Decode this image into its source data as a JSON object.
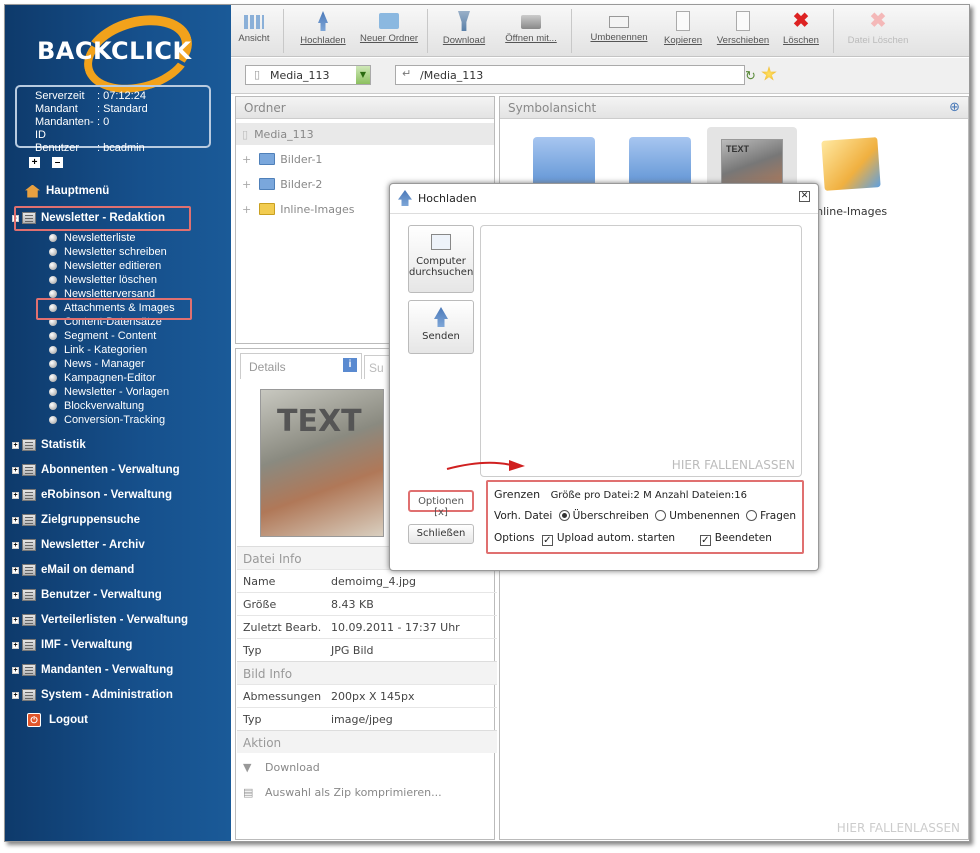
{
  "brand": {
    "logo_text": "BACKCLICK",
    "accent": "#f2a21b"
  },
  "server_info": [
    {
      "label": "Serverzeit",
      "value": ": 07:12:24"
    },
    {
      "label": "Mandant",
      "value": ": Standard"
    },
    {
      "label": "Mandanten-ID",
      "value": ": 0"
    },
    {
      "label": "Benutzer",
      "value": ": bcadmin"
    }
  ],
  "nav": {
    "home": "Hauptmenü",
    "active_section": "Newsletter - Redaktion",
    "sub_items": [
      "Newsletterliste",
      "Newsletter schreiben",
      "Newsletter editieren",
      "Newsletter löschen",
      "Newsletterversand",
      "Attachments & Images",
      "Content-Datensätze",
      "Segment - Content",
      "Link - Kategorien",
      "News - Manager",
      "Kampagnen-Editor",
      "Newsletter - Vorlagen",
      "Blockverwaltung",
      "Conversion-Tracking"
    ],
    "sections": [
      "Statistik",
      "Abonnenten - Verwaltung",
      "eRobinson - Verwaltung",
      "Zielgruppensuche",
      "Newsletter - Archiv",
      "eMail on demand",
      "Benutzer - Verwaltung",
      "Verteilerlisten - Verwaltung",
      "IMF - Verwaltung",
      "Mandanten - Verwaltung",
      "System - Administration"
    ],
    "logout": "Logout"
  },
  "toolbar": [
    "Ansicht",
    "Hochladen",
    "Neuer Ordner",
    "Download",
    "Öffnen mit...",
    "Umbenennen",
    "Kopieren",
    "Verschieben",
    "Löschen",
    "Datei Löschen"
  ],
  "path": {
    "root": "Media_113",
    "current": "/Media_113"
  },
  "folders_panel": {
    "title": "Ordner",
    "root": "Media_113",
    "items": [
      "Bilder-1",
      "Bilder-2",
      "Inline-Images"
    ]
  },
  "icons_panel": {
    "title": "Symbolansicht",
    "thumb_text": "TEXT",
    "thumb_label": "Inline-Images",
    "drop_hint": "HIER FALLENLASSEN"
  },
  "details": {
    "tab1": "Details",
    "tab2": "Su",
    "preview_text": "TEXT",
    "file_info_title": "Datei Info",
    "file_info": [
      {
        "k": "Name",
        "v": "demoimg_4.jpg"
      },
      {
        "k": "Größe",
        "v": "8.43 KB"
      },
      {
        "k": "Zuletzt Bearb.",
        "v": "10.09.2011 - 17:37 Uhr"
      },
      {
        "k": "Typ",
        "v": "JPG Bild"
      }
    ],
    "image_info_title": "Bild Info",
    "image_info": [
      {
        "k": "Abmessungen",
        "v": "200px X 145px"
      },
      {
        "k": "Typ",
        "v": "image/jpeg"
      }
    ],
    "action_title": "Aktion",
    "actions": [
      "Download",
      "Auswahl als Zip komprimieren..."
    ]
  },
  "dialog": {
    "title": "Hochladen",
    "browse_label": "Computer durchsuchen",
    "send_label": "Senden",
    "drop_hint": "HIER FALLENLASSEN",
    "options_button": "Optionen [x]",
    "close_button": "Schließen",
    "limits_label": "Grenzen",
    "limits_value": "Größe pro Datei:2 M  Anzahl Dateien:16",
    "existing_label": "Vorh. Datei",
    "existing_options": [
      "Überschreiben",
      "Umbenennen",
      "Fragen"
    ],
    "existing_selected": "Überschreiben",
    "options_label": "Options",
    "autostart_label": "Upload autom. starten",
    "autostart_checked": true,
    "finished_label": "Beendeten",
    "finished_checked": true
  }
}
